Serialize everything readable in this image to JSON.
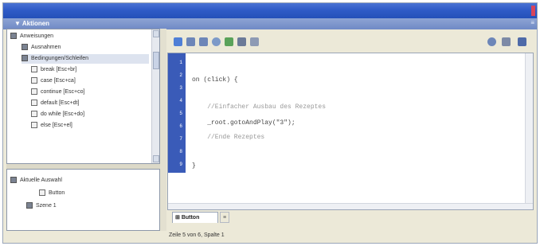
{
  "window": {
    "title": ""
  },
  "panel": {
    "title": "▼ Aktionen",
    "options_label": "≡"
  },
  "tree_top": {
    "items": [
      {
        "label": "Anweisungen",
        "icon": "book-icon"
      },
      {
        "label": "Ausnahmen",
        "icon": "book-icon"
      },
      {
        "label": "Bedingungen/Schleifen",
        "icon": "book-icon"
      },
      {
        "label": "break [Esc+br]",
        "icon": "statement-icon"
      },
      {
        "label": "case [Esc+ca]",
        "icon": "statement-icon"
      },
      {
        "label": "continue [Esc+co]",
        "icon": "statement-icon"
      },
      {
        "label": "default [Esc+dt]",
        "icon": "statement-icon"
      },
      {
        "label": "do while [Esc+do]",
        "icon": "statement-icon"
      },
      {
        "label": "else [Esc+el]",
        "icon": "statement-icon"
      }
    ]
  },
  "tree_bottom": {
    "items": [
      {
        "label": "Aktuelle Auswahl",
        "icon": "selection-icon"
      },
      {
        "label": "Button",
        "icon": "button-icon"
      },
      {
        "label": "Szene 1",
        "icon": "scene-icon"
      }
    ]
  },
  "toolbar": {
    "icons": [
      "add-action-icon",
      "find-icon",
      "replace-icon",
      "target-icon",
      "check-syntax-icon",
      "auto-format-icon",
      "code-hint-icon"
    ],
    "right_icons": [
      "debug-icon",
      "view-options-icon",
      "help-icon"
    ]
  },
  "editor": {
    "line_numbers": [
      "1",
      "2",
      "3",
      "4",
      "5",
      "6",
      "7",
      "8",
      "9"
    ],
    "lines": [
      {
        "text": "on (click) {",
        "kind": "code"
      },
      {
        "text": "",
        "kind": "code"
      },
      {
        "text": "    //Einfacher Ausbau des Rezeptes",
        "kind": "comment"
      },
      {
        "text": "    _root.gotoAndPlay(\"3\");",
        "kind": "code"
      },
      {
        "text": "    //Ende Rezeptes",
        "kind": "comment"
      },
      {
        "text": "",
        "kind": "code"
      },
      {
        "text": "}",
        "kind": "code"
      }
    ]
  },
  "tabs": {
    "active": "Button",
    "other": "≡"
  },
  "status": {
    "text": "Zeile 5 von 6, Spalte 1"
  },
  "colors": {
    "titlebar": "#2f5bc7",
    "gutter": "#3a5bb8",
    "panel_header": "#7a92cc"
  }
}
